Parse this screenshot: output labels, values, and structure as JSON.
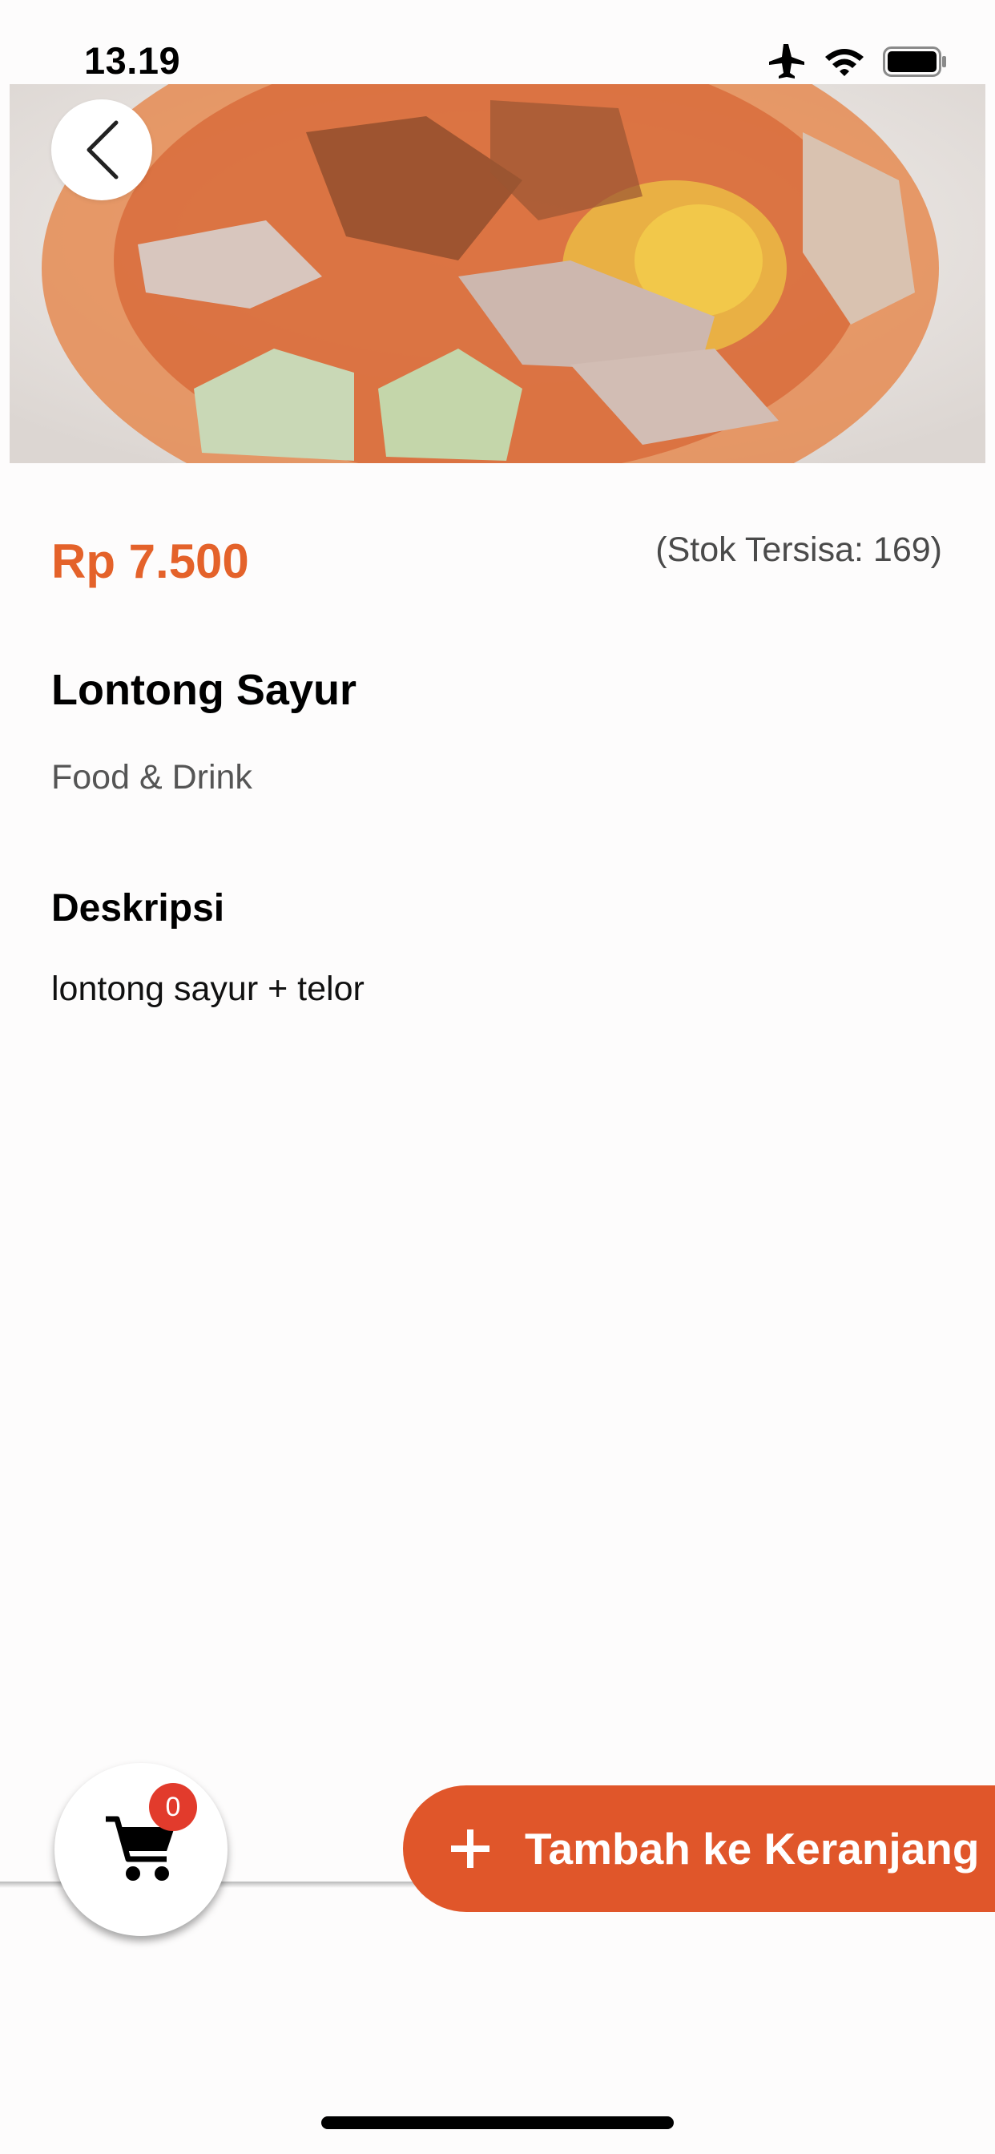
{
  "status_bar": {
    "time": "13.19",
    "icons": [
      "airplane-icon",
      "wifi-icon",
      "battery-icon"
    ]
  },
  "product": {
    "image_description": "Lontong sayur dish",
    "price": "Rp 7.500",
    "stock": "(Stok Tersisa: 169)",
    "name": "Lontong Sayur",
    "category": "Food & Drink",
    "description_heading": "Deskripsi",
    "description": "lontong sayur + telor"
  },
  "actions": {
    "back_icon": "chevron-left-icon",
    "cart_icon": "shopping-cart-icon",
    "cart_count": "0",
    "add_to_cart_label": "Tambah ke Keranjang",
    "add_icon": "plus-icon"
  },
  "colors": {
    "accent": "#e0562a",
    "price": "#e4622a",
    "badge": "#e23b2c"
  }
}
